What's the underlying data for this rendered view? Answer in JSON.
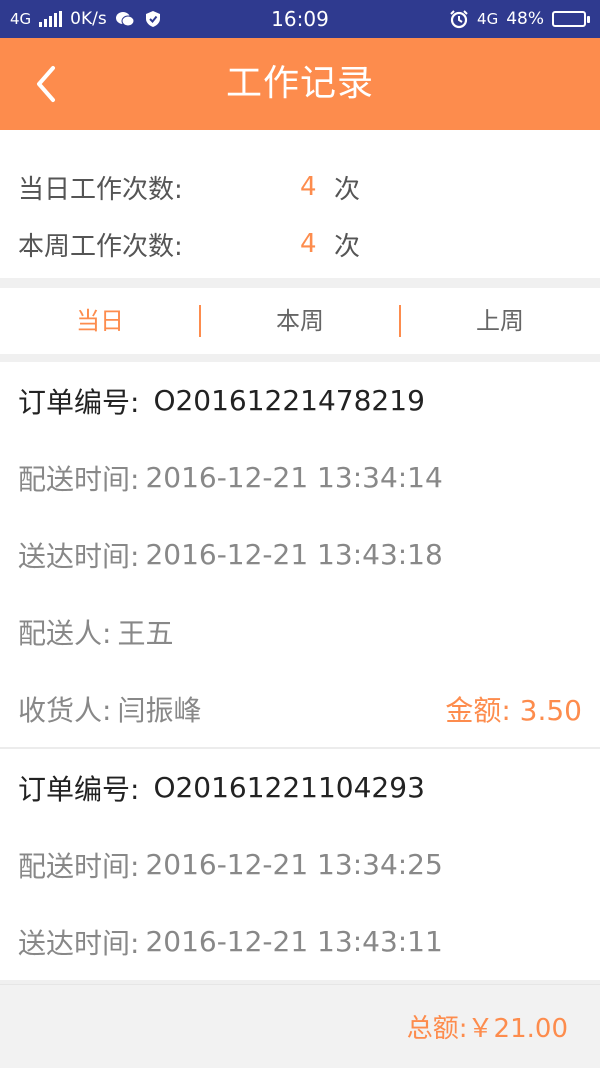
{
  "status_bar": {
    "network": "4G",
    "speed": "0K/s",
    "time": "16:09",
    "network_right": "4G",
    "battery_percent": "48%",
    "battery_level": 0.48
  },
  "header": {
    "title": "工作记录"
  },
  "summary": {
    "today": {
      "label": "当日工作次数:",
      "count": "4",
      "unit": "次"
    },
    "week": {
      "label": "本周工作次数:",
      "count": "4",
      "unit": "次"
    }
  },
  "tabs": [
    {
      "label": "当日"
    },
    {
      "label": "本周"
    },
    {
      "label": "上周"
    }
  ],
  "orders": [
    {
      "order_no_label": "订单编号:",
      "order_no": "O20161221478219",
      "dispatch_label": "配送时间:",
      "dispatch_time": "2016-12-21 13:34:14",
      "delivered_label": "送达时间:",
      "delivered_time": "2016-12-21 13:43:18",
      "courier_label": "配送人:",
      "courier": "王五",
      "receiver_label": "收货人:",
      "receiver": "闫振峰",
      "amount_label": "金额:",
      "amount": "3.50"
    },
    {
      "order_no_label": "订单编号:",
      "order_no": "O20161221104293",
      "dispatch_label": "配送时间:",
      "dispatch_time": "2016-12-21 13:34:25",
      "delivered_label": "送达时间:",
      "delivered_time": "2016-12-21 13:43:11"
    }
  ],
  "footer": {
    "total": "总额:￥21.00"
  }
}
